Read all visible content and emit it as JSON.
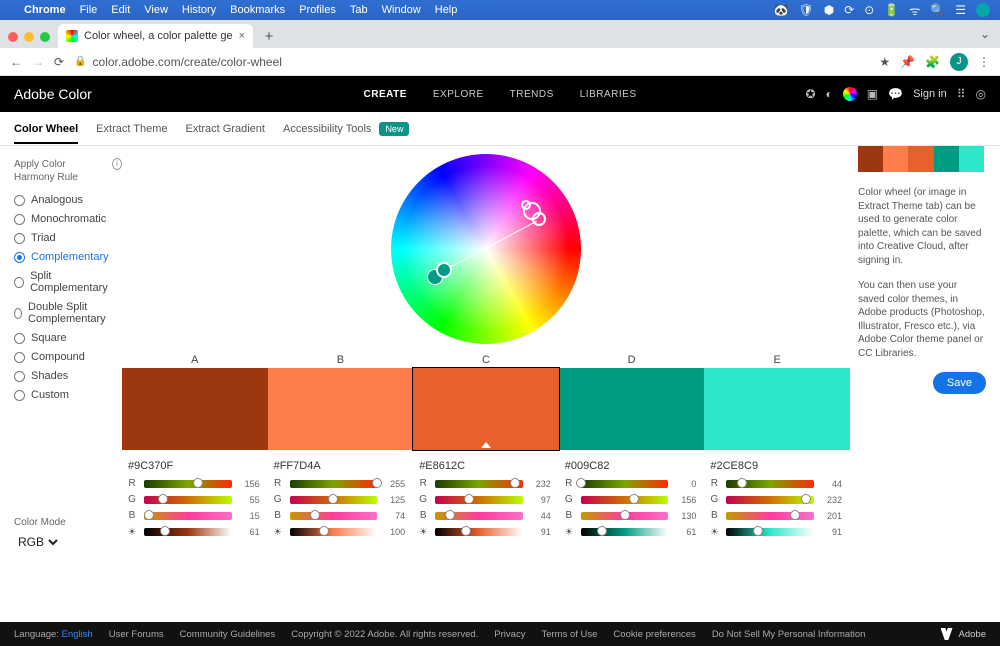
{
  "os_menu": {
    "apple": "",
    "items": [
      "Chrome",
      "File",
      "Edit",
      "View",
      "History",
      "Bookmarks",
      "Profiles",
      "Tab",
      "Window",
      "Help"
    ],
    "right_icons": [
      "🐼",
      "🛡",
      "⬢",
      "⟳",
      "⊙",
      "🔋",
      "ᯤ",
      "🔍",
      "☰",
      "◐"
    ]
  },
  "browser": {
    "tab_title": "Color wheel, a color palette ge",
    "url": "color.adobe.com/create/color-wheel",
    "ext_icons": [
      "★",
      "📌",
      "🧩",
      "⋮"
    ],
    "avatar_letter": "J"
  },
  "app": {
    "brand": "Adobe Color",
    "nav": [
      "CREATE",
      "EXPLORE",
      "TRENDS",
      "LIBRARIES"
    ],
    "right": {
      "signin": "Sign in"
    }
  },
  "subnav": {
    "items": [
      "Color Wheel",
      "Extract Theme",
      "Extract Gradient",
      "Accessibility Tools"
    ],
    "badge": "New"
  },
  "harmony": {
    "header": "Apply Color Harmony Rule",
    "rules": [
      "Analogous",
      "Monochromatic",
      "Triad",
      "Complementary",
      "Split Complementary",
      "Double Split Complementary",
      "Square",
      "Compound",
      "Shades",
      "Custom"
    ],
    "selected": "Complementary"
  },
  "color_mode": {
    "label": "Color Mode",
    "value": "RGB"
  },
  "swatches": {
    "labels": [
      "A",
      "B",
      "C",
      "D",
      "E"
    ],
    "colors": [
      "#9C370F",
      "#FF7D4A",
      "#E8612C",
      "#009C82",
      "#2CE8C9"
    ],
    "selected_index": 2,
    "channels": [
      "R",
      "G",
      "B"
    ],
    "values": [
      {
        "r": 156,
        "g": 55,
        "b": 15,
        "l": 61
      },
      {
        "r": 255,
        "g": 125,
        "b": 74,
        "l": 100
      },
      {
        "r": 232,
        "g": 97,
        "b": 44,
        "l": 91
      },
      {
        "r": 0,
        "g": 156,
        "b": 130,
        "l": 61
      },
      {
        "r": 44,
        "g": 232,
        "b": 201,
        "l": 91
      }
    ]
  },
  "info": {
    "p1": "Color wheel (or image in Extract Theme tab) can be used to generate color palette, which can be saved into Creative Cloud, after signing in.",
    "p2": "You can then use your saved color themes, in Adobe products (Photoshop, Illustrator, Fresco etc.), via Adobe Color theme panel or CC Libraries.",
    "save": "Save"
  },
  "footer": {
    "language_label": "Language:",
    "language": "English",
    "links": [
      "User Forums",
      "Community Guidelines",
      "Copyright © 2022 Adobe. All rights reserved.",
      "Privacy",
      "Terms of Use",
      "Cookie preferences",
      "Do Not Sell My Personal Information"
    ],
    "brand": "Adobe"
  }
}
